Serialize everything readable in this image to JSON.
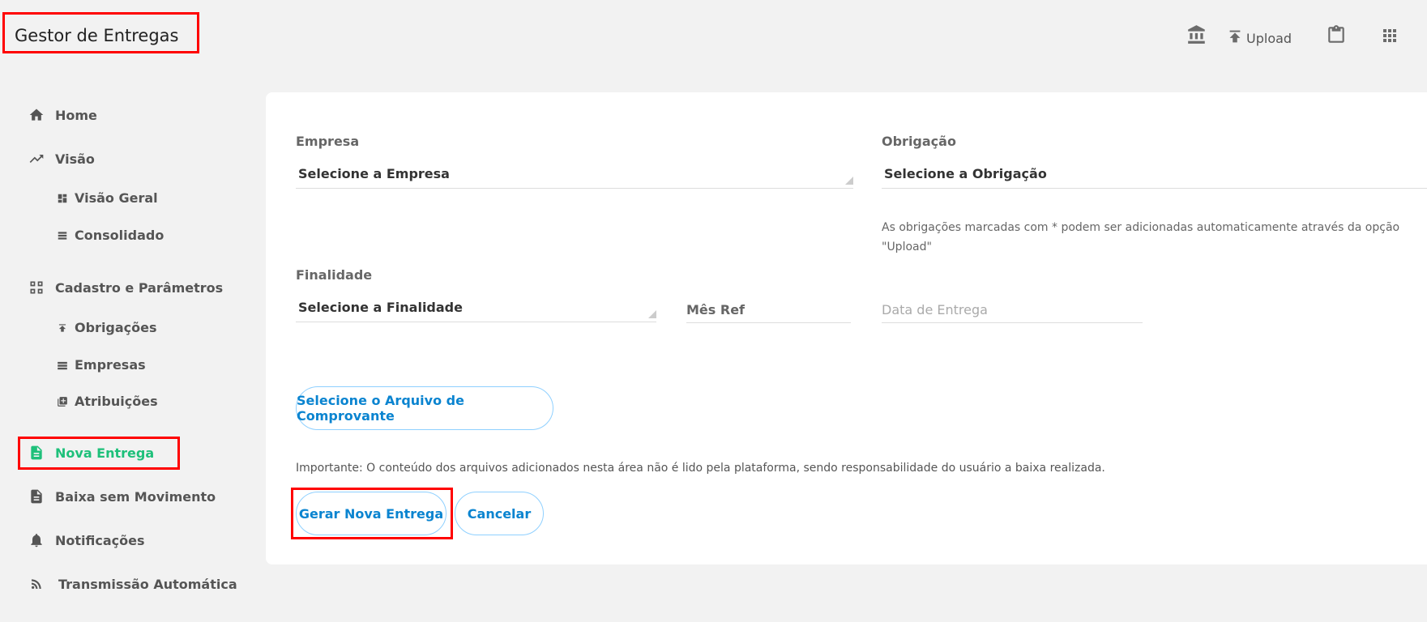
{
  "header": {
    "app_title": "Gestor de Entregas",
    "upload_label": "Upload"
  },
  "sidebar": {
    "items": [
      {
        "label": "Home",
        "icon": "home-icon"
      },
      {
        "label": "Visão",
        "icon": "trending-up-icon"
      },
      {
        "label": "Visão Geral",
        "icon": "dashboard-icon"
      },
      {
        "label": "Consolidado",
        "icon": "list-icon"
      },
      {
        "label": "Cadastro e Parâmetros",
        "icon": "settings-box-icon"
      },
      {
        "label": "Obrigações",
        "icon": "upload-icon"
      },
      {
        "label": "Empresas",
        "icon": "table-icon"
      },
      {
        "label": "Atribuições",
        "icon": "library-add-icon"
      },
      {
        "label": "Nova Entrega",
        "icon": "document-icon"
      },
      {
        "label": "Baixa sem Movimento",
        "icon": "document-icon"
      },
      {
        "label": "Notificações",
        "icon": "bell-icon"
      },
      {
        "label": "Transmissão Automática",
        "icon": "rss-icon"
      }
    ],
    "active_color": "#1ec07a"
  },
  "form": {
    "empresa_label": "Empresa",
    "empresa_value": "Selecione a Empresa",
    "obrigacao_label": "Obrigação",
    "obrigacao_value": "Selecione a Obrigação",
    "obrigacao_hint_line1": "As obrigações marcadas com * podem ser adicionadas automaticamente através da opção",
    "obrigacao_hint_line2": "\"Upload\"",
    "finalidade_label": "Finalidade",
    "finalidade_value": "Selecione a Finalidade",
    "mes_ref_label": "Mês Ref",
    "data_entrega_placeholder": "Data de Entrega",
    "select_file_button": "Selecione o Arquivo de Comprovante",
    "important_note": "Importante: O conteúdo dos arquivos adicionados nesta área não é lido pela plataforma, sendo responsabilidade do usuário a baixa realizada.",
    "generate_button": "Gerar Nova Entrega",
    "cancel_button": "Cancelar"
  },
  "colors": {
    "accent": "#0a84d0",
    "highlight": "#ff0000"
  }
}
